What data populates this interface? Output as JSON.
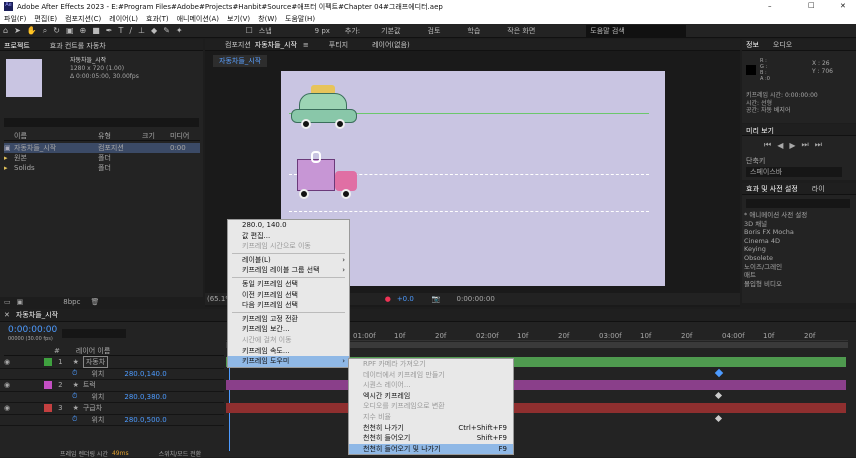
{
  "window": {
    "title": "Adobe After Effects 2023 - E:#Program Files#Adobe#Projects#Hanbit#Source#애프터 이펙트#Chapter 04#그래프에디터.aep",
    "min": "–",
    "max": "□",
    "close": "✕"
  },
  "menu": [
    "파일(F)",
    "편집(E)",
    "컴포지션(C)",
    "레이어(L)",
    "효과(T)",
    "애니메이션(A)",
    "보기(V)",
    "창(W)",
    "도움말(H)"
  ],
  "toolbar": {
    "snap": "스냅",
    "px": "9 px",
    "add": "추가:",
    "workspaces": [
      "기본값",
      "검토",
      "학습",
      "작은 화면"
    ],
    "search_placeholder": "도움말 검색"
  },
  "project": {
    "tab": "프로젝트",
    "tab2": "효과 컨트롤 자동차",
    "comp_name": "자동차들_시작",
    "info1": "1280 x 720 (1.00)",
    "info2": "Δ 0:00:05:00, 30.00fps",
    "col_name": "이름",
    "col_type": "유형",
    "col_size": "크기",
    "col_media": "미디어",
    "items": [
      {
        "name": "자동차들_시작",
        "type": "컴포지션",
        "size": "",
        "media": "0:00"
      },
      {
        "name": "원본",
        "type": "폴더",
        "size": "",
        "media": ""
      },
      {
        "name": "Solids",
        "type": "폴더",
        "size": "",
        "media": ""
      }
    ],
    "bpc": "8bpc"
  },
  "comp": {
    "tab": "컴포지션",
    "tab_name": "자동차들_시작",
    "tab_menu": "≡",
    "layer_tab": "레이어(없음)",
    "footage_tab": "푸티지",
    "viewer_tab": "자동차들_시작",
    "zoom": "(65.1%)",
    "time": "0:00:00:00",
    "delta": "+0.0"
  },
  "info": {
    "tab": "정보",
    "audio_tab": "오디오",
    "r": "R :",
    "g": "G :",
    "b": "B :",
    "a": "A :0",
    "x": "X : 26",
    "y": "Y : 706",
    "line1": "키프레임 시간: 0:00:00:00",
    "line2": "시간: 선형",
    "line3": "공간: 자동 베지어"
  },
  "preview": {
    "tab": "미리 보기",
    "shortcut_label": "단축키",
    "shortcut_value": "스페이스바"
  },
  "effects": {
    "tab": "효과 및 사전 설정",
    "tab2": "라이",
    "items": [
      "* 애니메이션 사전 설정",
      "3D 채널",
      "Boris FX Mocha",
      "Cinema 4D",
      "Keying",
      "Obsolete",
      "노이즈/그레인",
      "매트",
      "몰입형 비디오"
    ]
  },
  "timeline": {
    "tab": "자동차들_시작",
    "time": "0:00:00:00",
    "fps": "00000 (30.00 fps)",
    "col_num": "#",
    "col_name": "레이어 이름",
    "parent_col": "부모 및 링크",
    "ruler": [
      "0f",
      "10f",
      "20f",
      "01:00f",
      "10f",
      "20f",
      "02:00f",
      "10f",
      "20f",
      "03:00f",
      "10f",
      "20f",
      "04:00f",
      "10f",
      "20f"
    ],
    "layers": [
      {
        "num": "1",
        "name": "자동차",
        "color": "#3fa13f",
        "prop": "위치",
        "value": "280.0,140.0",
        "parent": "없음"
      },
      {
        "num": "2",
        "name": "트럭",
        "color": "#c34fc3",
        "prop": "위치",
        "value": "280.0,380.0",
        "parent": "없음"
      },
      {
        "num": "3",
        "name": "구급차",
        "color": "#c44040",
        "prop": "위치",
        "value": "280.0,500.0",
        "parent": "없음"
      }
    ],
    "footer": "프레임 렌더링 시간",
    "footer_ms": "49ms",
    "footer_mode": "스위치/모드 전환"
  },
  "context_menu": {
    "items": [
      {
        "label": "280.0, 140.0",
        "dis": false,
        "arrow": false
      },
      {
        "label": "값 편집...",
        "dis": false,
        "arrow": false
      },
      {
        "label": "키프레임 시간으로 이동",
        "dis": true,
        "arrow": false
      },
      {
        "sep": true
      },
      {
        "label": "레이블(L)",
        "dis": false,
        "arrow": true
      },
      {
        "label": "키프레임 레이블 그룹 선택",
        "dis": false,
        "arrow": true
      },
      {
        "sep": true
      },
      {
        "label": "동일 키프레임 선택",
        "dis": false,
        "arrow": false
      },
      {
        "label": "이전 키프레임 선택",
        "dis": false,
        "arrow": false
      },
      {
        "label": "다음 키프레임 선택",
        "dis": false,
        "arrow": false
      },
      {
        "sep": true
      },
      {
        "label": "키프레임 고정 전환",
        "dis": false,
        "arrow": false
      },
      {
        "label": "키프레임 보간...",
        "dis": false,
        "arrow": false
      },
      {
        "label": "시간에 걸쳐 이동",
        "dis": true,
        "arrow": false
      },
      {
        "label": "키프레임 속도...",
        "dis": false,
        "arrow": false
      },
      {
        "label": "키프레임 도우미",
        "dis": false,
        "arrow": true,
        "hl": true
      }
    ],
    "sub": [
      {
        "label": "RPF 카메라 가져오기",
        "key": "",
        "dis": true
      },
      {
        "label": "데이터에서 키프레임 만들기",
        "key": "",
        "dis": true
      },
      {
        "label": "시퀀스 레이어...",
        "key": "",
        "dis": true
      },
      {
        "label": "엑시간 키프레임",
        "key": "",
        "dis": false
      },
      {
        "label": "오디오를 키프레임으로 변환",
        "key": "",
        "dis": true
      },
      {
        "label": "지수 비율",
        "key": "",
        "dis": true
      },
      {
        "label": "천천히 나가기",
        "key": "Ctrl+Shift+F9",
        "dis": false
      },
      {
        "label": "천천히 들어오기",
        "key": "Shift+F9",
        "dis": false
      },
      {
        "label": "천천히 들어오기 및 나가기",
        "key": "F9",
        "dis": false,
        "hl": true
      }
    ]
  }
}
